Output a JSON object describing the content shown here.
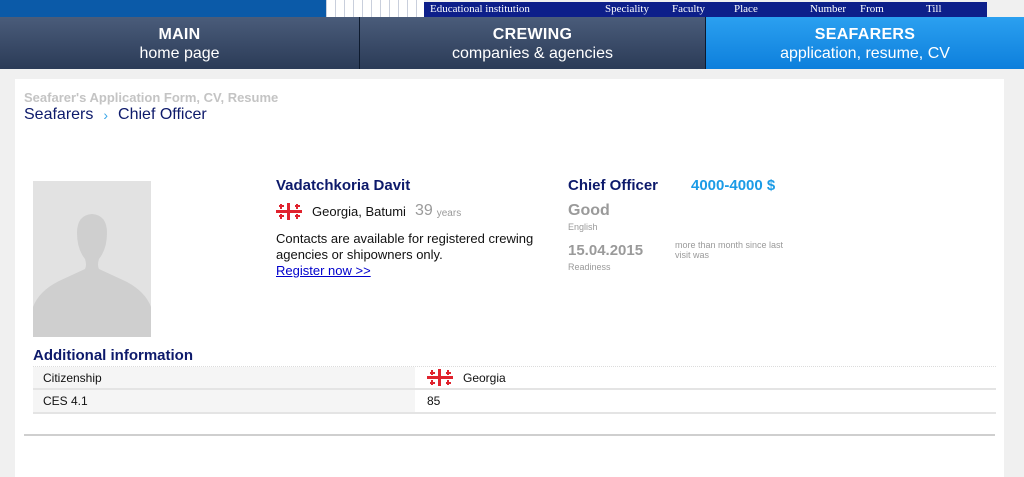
{
  "top_header": {
    "columns": [
      "Educational institution",
      "Speciality",
      "Faculty",
      "Place",
      "Number",
      "From",
      "Till"
    ]
  },
  "nav": {
    "tabs": [
      {
        "title": "MAIN",
        "subtitle": "home page"
      },
      {
        "title": "CREWING",
        "subtitle": "companies & agencies"
      },
      {
        "title": "SEAFARERS",
        "subtitle": "application, resume, CV"
      }
    ]
  },
  "breadcrumb": {
    "caption": "Seafarer's Application Form, CV, Resume",
    "items": [
      "Seafarers",
      "Chief Officer"
    ]
  },
  "profile": {
    "name": "Vadatchkoria Davit",
    "location": "Georgia, Batumi",
    "age": "39",
    "age_unit": "years",
    "contacts_note": "Contacts are available for registered crewing agencies or shipowners only.",
    "register_link": "Register now >>",
    "rank": "Chief Officer",
    "salary": "4000-4000 $",
    "english_level": "Good",
    "english_label": "English",
    "readiness_date": "15.04.2015",
    "readiness_label": "Readiness",
    "last_visit": "more than month since last visit was"
  },
  "additional": {
    "title": "Additional information",
    "rows": [
      {
        "label": "Citizenship",
        "value": "Georgia"
      },
      {
        "label": "CES 4.1",
        "value": "85"
      }
    ]
  },
  "colors": {
    "brand_navy": "#0d1a6b",
    "accent_blue": "#1b9be6",
    "flag_red": "#e0232e"
  },
  "icons": {
    "flag": "georgia-flag-icon",
    "breadcrumb_sep": "chevron-right-icon"
  }
}
